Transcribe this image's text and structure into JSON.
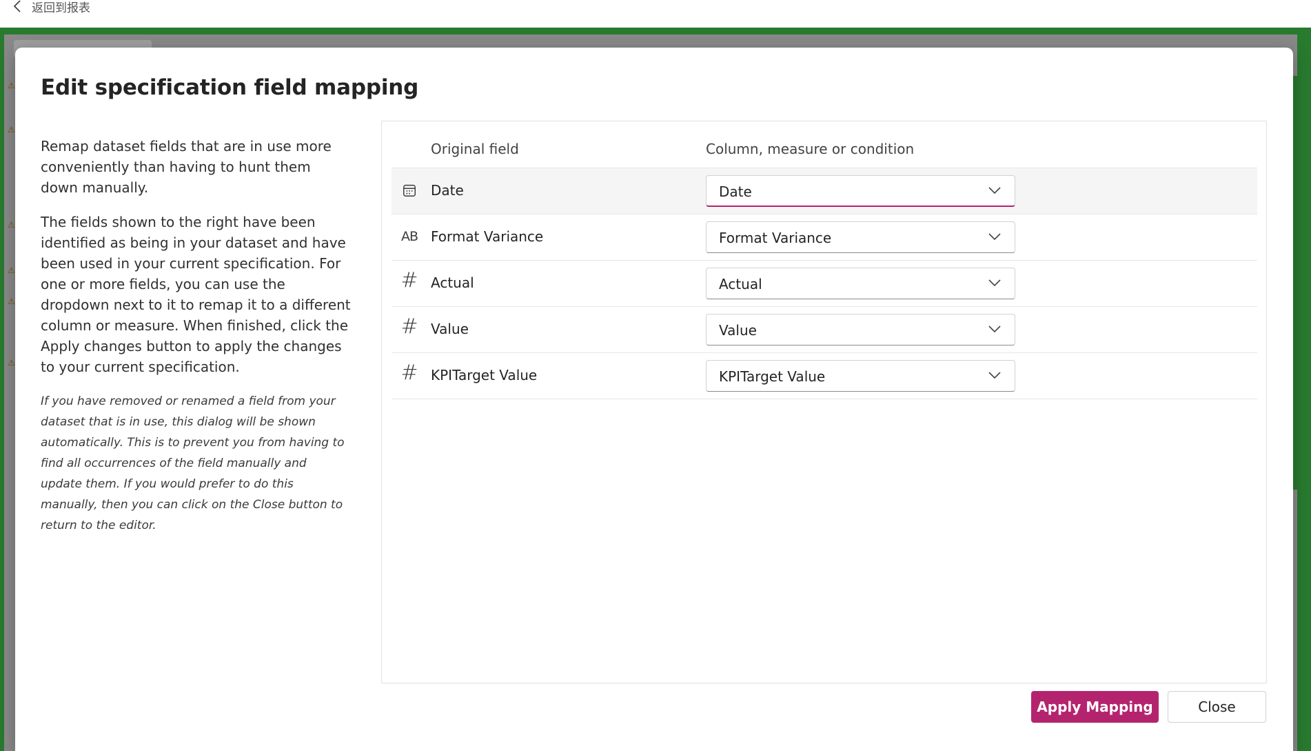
{
  "topbar": {
    "back_label": "返回到报表"
  },
  "dialog": {
    "title": "Edit specification field mapping",
    "description": {
      "para1": "Remap dataset fields that are in use more conveniently than having to hunt them down manually.",
      "para2": "The fields shown to the right have been identified as being in your dataset and have been used in your current specification. For one or more fields, you can use the dropdown next to it to remap it to a different column or measure. When finished, click the Apply changes button to apply the changes to your current specification.",
      "note": "If you have removed or renamed a field from your dataset that is in use, this dialog will be shown automatically. This is to prevent you from having to find all occurrences of the field manually and update them. If you would prefer to do this manually, then you can click on the Close button to return to the editor."
    },
    "grid": {
      "headers": {
        "original": "Original field",
        "mapping": "Column, measure or condition"
      },
      "rows": [
        {
          "icon": "calendar-icon",
          "field": "Date",
          "mapped": "Date",
          "selected": true
        },
        {
          "icon": "text-ab-icon",
          "field": "Format Variance",
          "mapped": "Format Variance",
          "selected": false
        },
        {
          "icon": "hash-icon",
          "field": "Actual",
          "mapped": "Actual",
          "selected": false
        },
        {
          "icon": "hash-icon",
          "field": "Value",
          "mapped": "Value",
          "selected": false
        },
        {
          "icon": "hash-icon",
          "field": "KPITarget Value",
          "mapped": "KPITarget Value",
          "selected": false
        }
      ]
    },
    "buttons": {
      "apply": "Apply Mapping",
      "close": "Close"
    }
  },
  "colors": {
    "accent": "#b4246e",
    "frame_green": "#2e8b36"
  }
}
